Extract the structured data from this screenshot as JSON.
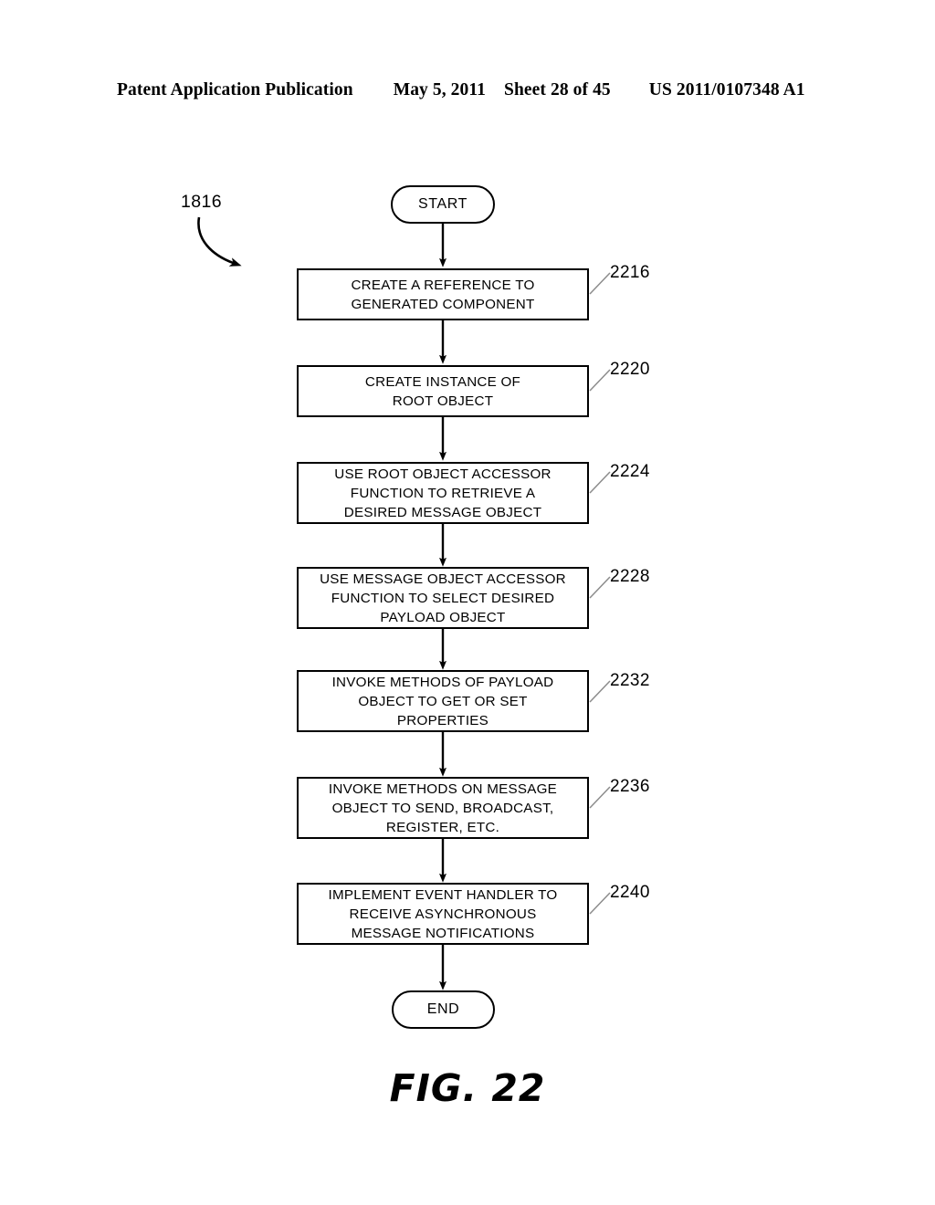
{
  "header": {
    "publication": "Patent Application Publication",
    "date": "May 5, 2011",
    "sheet": "Sheet 28 of 45",
    "patent_number": "US 2011/0107348 A1"
  },
  "figure": {
    "caption": "FIG. 22",
    "diagram_ref": "1816",
    "start_label": "START",
    "end_label": "END"
  },
  "flow": {
    "steps": [
      {
        "ref": "2216",
        "text": "CREATE A REFERENCE TO\nGENERATED COMPONENT",
        "lines": 2
      },
      {
        "ref": "2220",
        "text": "CREATE INSTANCE OF\nROOT OBJECT",
        "lines": 2
      },
      {
        "ref": "2224",
        "text": "USE ROOT OBJECT ACCESSOR\nFUNCTION TO RETRIEVE A\nDESIRED MESSAGE OBJECT",
        "lines": 3
      },
      {
        "ref": "2228",
        "text": "USE MESSAGE OBJECT ACCESSOR\nFUNCTION TO SELECT DESIRED\nPAYLOAD OBJECT",
        "lines": 3
      },
      {
        "ref": "2232",
        "text": "INVOKE METHODS OF PAYLOAD\nOBJECT TO GET OR SET\nPROPERTIES",
        "lines": 3
      },
      {
        "ref": "2236",
        "text": "INVOKE METHODS ON MESSAGE\nOBJECT TO SEND, BROADCAST,\nREGISTER, ETC.",
        "lines": 3
      },
      {
        "ref": "2240",
        "text": "IMPLEMENT EVENT HANDLER TO\nRECEIVE ASYNCHRONOUS\nMESSAGE NOTIFICATIONS",
        "lines": 3
      }
    ]
  },
  "colors": {
    "ink": "#000000",
    "paper": "#ffffff",
    "leader_line": "#8c8c8c"
  }
}
